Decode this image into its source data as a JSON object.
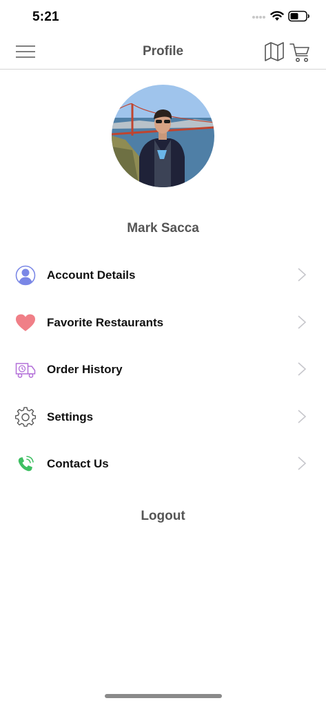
{
  "status_bar": {
    "time": "5:21"
  },
  "nav": {
    "title": "Profile",
    "icons": [
      "menu-icon",
      "map-icon",
      "cart-icon"
    ]
  },
  "profile": {
    "name": "Mark Sacca"
  },
  "menu": {
    "items": [
      {
        "label": "Account Details",
        "icon": "user-icon",
        "color": "#7a87e6"
      },
      {
        "label": "Favorite Restaurants",
        "icon": "heart-icon",
        "color": "#f07f87"
      },
      {
        "label": "Order History",
        "icon": "delivery-truck-icon",
        "color": "#b26ed8"
      },
      {
        "label": "Settings",
        "icon": "gear-icon",
        "color": "#555555"
      },
      {
        "label": "Contact Us",
        "icon": "phone-icon",
        "color": "#3fbf63"
      }
    ]
  },
  "logout_label": "Logout"
}
